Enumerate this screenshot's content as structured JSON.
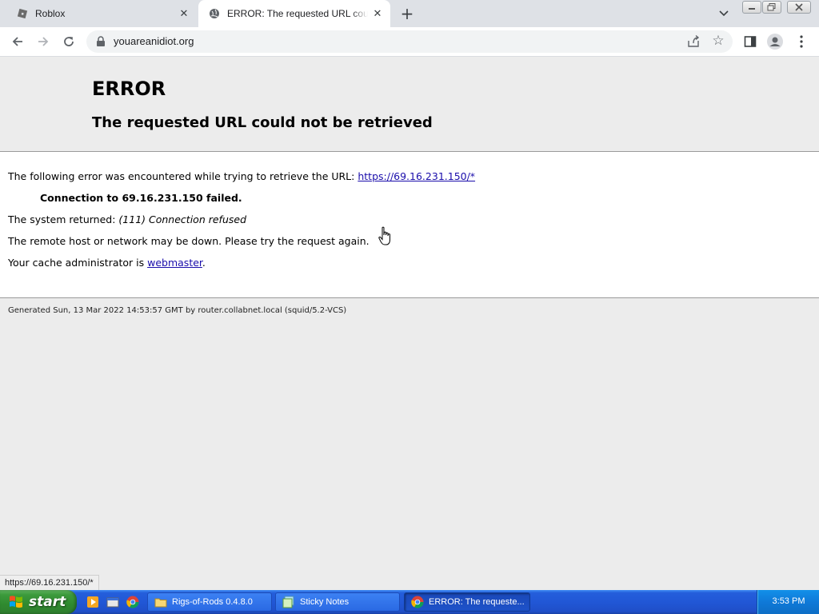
{
  "browser": {
    "tabs": [
      {
        "title": "Roblox",
        "icon": "roblox-icon",
        "active": false
      },
      {
        "title": "ERROR: The requested URL could not be retrieved",
        "icon": "globe-icon",
        "active": true
      }
    ],
    "address": "youareanidiot.org",
    "status_url": "https://69.16.231.150/*"
  },
  "page": {
    "h1": "ERROR",
    "h2": "The requested URL could not be retrieved",
    "intro_text": "The following error was encountered while trying to retrieve the URL: ",
    "intro_link": "https://69.16.231.150/*",
    "error_detail": "Connection to 69.16.231.150 failed.",
    "system_prefix": "The system returned: ",
    "system_value": "(111) Connection refused",
    "remote_text": "The remote host or network may be down. Please try the request again.",
    "cache_text": "Your cache administrator is ",
    "cache_link": "webmaster",
    "cache_suffix": ".",
    "footer": "Generated Sun, 13 Mar 2022 14:53:57 GMT by router.collabnet.local (squid/5.2-VCS)"
  },
  "taskbar": {
    "start_label": "start",
    "buttons": [
      {
        "label": "Rigs-of-Rods 0.4.8.0",
        "icon": "folder-icon",
        "active": false
      },
      {
        "label": "Sticky Notes",
        "icon": "sticky-notes-icon",
        "active": false
      },
      {
        "label": "ERROR: The requeste...",
        "icon": "chrome-icon",
        "active": true
      }
    ],
    "clock": "3:53 PM"
  },
  "colors": {
    "tabstrip_bg": "#dee1e6",
    "link": "#1a0dab",
    "taskbar_blue": "#245edb",
    "start_green": "#3c9a3c"
  }
}
